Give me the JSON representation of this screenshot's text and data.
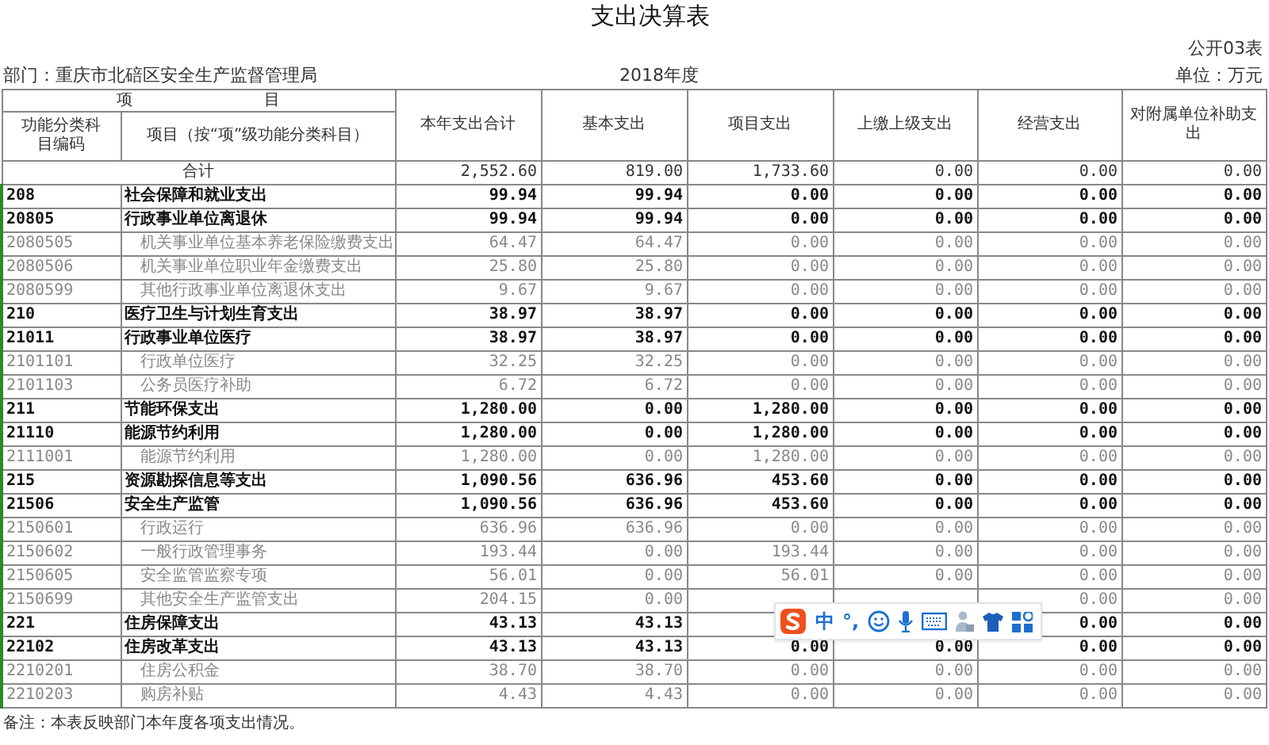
{
  "title": "支出决算表",
  "form_no": "公开03表",
  "department": "部门：重庆市北碚区安全生产监督管理局",
  "year": "2018年度",
  "unit": "单位：万元",
  "header_group": "项 目",
  "columns": [
    "功能分类科目编码",
    "项目（按“项”级功能分类科目）",
    "本年支出合计",
    "基本支出",
    "项目支出",
    "上缴上级支出",
    "经营支出",
    "对附属单位补助支出"
  ],
  "total": {
    "label": "合计",
    "values": {
      "total": "2,552.60",
      "basic": "819.00",
      "project": "1,733.60",
      "remit": "0.00",
      "operating": "0.00",
      "subsidy": "0.00"
    }
  },
  "rows": [
    {
      "kind": "category",
      "code": "208",
      "name": "社会保障和就业支出",
      "values": {
        "total": "99.94",
        "basic": "99.94",
        "project": "0.00",
        "remit": "0.00",
        "operating": "0.00",
        "subsidy": "0.00"
      }
    },
    {
      "kind": "category",
      "code": "20805",
      "name": "行政事业单位离退休",
      "values": {
        "total": "99.94",
        "basic": "99.94",
        "project": "0.00",
        "remit": "0.00",
        "operating": "0.00",
        "subsidy": "0.00"
      }
    },
    {
      "kind": "detail",
      "code": "2080505",
      "name": "机关事业单位基本养老保险缴费支出",
      "values": {
        "total": "64.47",
        "basic": "64.47",
        "project": "0.00",
        "remit": "0.00",
        "operating": "0.00",
        "subsidy": "0.00"
      }
    },
    {
      "kind": "detail",
      "code": "2080506",
      "name": "机关事业单位职业年金缴费支出",
      "values": {
        "total": "25.80",
        "basic": "25.80",
        "project": "0.00",
        "remit": "0.00",
        "operating": "0.00",
        "subsidy": "0.00"
      }
    },
    {
      "kind": "detail",
      "code": "2080599",
      "name": "其他行政事业单位离退休支出",
      "values": {
        "total": "9.67",
        "basic": "9.67",
        "project": "0.00",
        "remit": "0.00",
        "operating": "0.00",
        "subsidy": "0.00"
      }
    },
    {
      "kind": "category",
      "code": "210",
      "name": "医疗卫生与计划生育支出",
      "values": {
        "total": "38.97",
        "basic": "38.97",
        "project": "0.00",
        "remit": "0.00",
        "operating": "0.00",
        "subsidy": "0.00"
      }
    },
    {
      "kind": "category",
      "code": "21011",
      "name": "行政事业单位医疗",
      "values": {
        "total": "38.97",
        "basic": "38.97",
        "project": "0.00",
        "remit": "0.00",
        "operating": "0.00",
        "subsidy": "0.00"
      }
    },
    {
      "kind": "detail",
      "code": "2101101",
      "name": "行政单位医疗",
      "values": {
        "total": "32.25",
        "basic": "32.25",
        "project": "0.00",
        "remit": "0.00",
        "operating": "0.00",
        "subsidy": "0.00"
      }
    },
    {
      "kind": "detail",
      "code": "2101103",
      "name": "公务员医疗补助",
      "values": {
        "total": "6.72",
        "basic": "6.72",
        "project": "0.00",
        "remit": "0.00",
        "operating": "0.00",
        "subsidy": "0.00"
      }
    },
    {
      "kind": "category",
      "code": "211",
      "name": "节能环保支出",
      "values": {
        "total": "1,280.00",
        "basic": "0.00",
        "project": "1,280.00",
        "remit": "0.00",
        "operating": "0.00",
        "subsidy": "0.00"
      }
    },
    {
      "kind": "category",
      "code": "21110",
      "name": "能源节约利用",
      "values": {
        "total": "1,280.00",
        "basic": "0.00",
        "project": "1,280.00",
        "remit": "0.00",
        "operating": "0.00",
        "subsidy": "0.00"
      }
    },
    {
      "kind": "detail",
      "code": "2111001",
      "name": "能源节约利用",
      "values": {
        "total": "1,280.00",
        "basic": "0.00",
        "project": "1,280.00",
        "remit": "0.00",
        "operating": "0.00",
        "subsidy": "0.00"
      }
    },
    {
      "kind": "category",
      "code": "215",
      "name": "资源勘探信息等支出",
      "values": {
        "total": "1,090.56",
        "basic": "636.96",
        "project": "453.60",
        "remit": "0.00",
        "operating": "0.00",
        "subsidy": "0.00"
      }
    },
    {
      "kind": "category",
      "code": "21506",
      "name": "安全生产监管",
      "values": {
        "total": "1,090.56",
        "basic": "636.96",
        "project": "453.60",
        "remit": "0.00",
        "operating": "0.00",
        "subsidy": "0.00"
      }
    },
    {
      "kind": "detail",
      "code": "2150601",
      "name": "行政运行",
      "values": {
        "total": "636.96",
        "basic": "636.96",
        "project": "0.00",
        "remit": "0.00",
        "operating": "0.00",
        "subsidy": "0.00"
      }
    },
    {
      "kind": "detail",
      "code": "2150602",
      "name": "一般行政管理事务",
      "values": {
        "total": "193.44",
        "basic": "0.00",
        "project": "193.44",
        "remit": "0.00",
        "operating": "0.00",
        "subsidy": "0.00"
      }
    },
    {
      "kind": "detail",
      "code": "2150605",
      "name": "安全监管监察专项",
      "values": {
        "total": "56.01",
        "basic": "0.00",
        "project": "56.01",
        "remit": "0.00",
        "operating": "0.00",
        "subsidy": "0.00"
      }
    },
    {
      "kind": "detail",
      "code": "2150699",
      "name": "其他安全生产监管支出",
      "values": {
        "total": "204.15",
        "basic": "0.00",
        "operating": "0.00",
        "subsidy": "0.00"
      }
    },
    {
      "kind": "category",
      "code": "221",
      "name": "住房保障支出",
      "values": {
        "total": "43.13",
        "basic": "43.13",
        "operating": "0.00",
        "subsidy": "0.00"
      }
    },
    {
      "kind": "category",
      "code": "22102",
      "name": "住房改革支出",
      "values": {
        "total": "43.13",
        "basic": "43.13",
        "project": "0.00",
        "remit": "0.00",
        "operating": "0.00",
        "subsidy": "0.00"
      }
    },
    {
      "kind": "detail",
      "code": "2210201",
      "name": "住房公积金",
      "values": {
        "total": "38.70",
        "basic": "38.70",
        "project": "0.00",
        "remit": "0.00",
        "operating": "0.00",
        "subsidy": "0.00"
      }
    },
    {
      "kind": "detail",
      "code": "2210203",
      "name": "购房补贴",
      "values": {
        "total": "4.43",
        "basic": "4.43",
        "project": "0.00",
        "remit": "0.00",
        "operating": "0.00",
        "subsidy": "0.00"
      }
    }
  ],
  "note": "备注：本表反映部门本年度各项支出情况。",
  "ime_toolbar": {
    "mode": "中",
    "punctuation": "°,"
  }
}
